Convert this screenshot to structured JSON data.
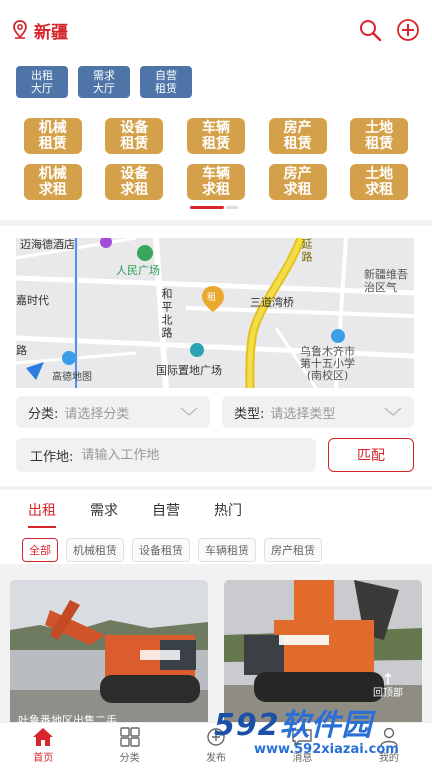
{
  "header": {
    "city": "新疆",
    "icons": [
      "location-pin-icon",
      "search-icon",
      "add-circle-icon"
    ],
    "accent": "#d7262b"
  },
  "halls": [
    {
      "label": "出租\n大厅"
    },
    {
      "label": "需求\n大厅"
    },
    {
      "label": "自营\n租赁"
    }
  ],
  "categories": [
    {
      "label": "机械\n租赁"
    },
    {
      "label": "设备\n租赁"
    },
    {
      "label": "车辆\n租赁"
    },
    {
      "label": "房产\n租赁"
    },
    {
      "label": "土地\n租赁"
    },
    {
      "label": "机械\n求租"
    },
    {
      "label": "设备\n求租"
    },
    {
      "label": "车辆\n求租"
    },
    {
      "label": "房产\n求租"
    },
    {
      "label": "土地\n求租"
    }
  ],
  "map": {
    "labels": {
      "hotel": "迈海德酒店",
      "people_square": "人民广场",
      "era": "嘉时代",
      "heping_road": "和平北路",
      "rent_marker": "租",
      "sandaowan": "三道湾桥",
      "xinjiang_uyghur": "新疆维吾\n治区气",
      "intl_plaza": "国际置地广场",
      "school": "乌鲁木齐市\n第十五小学\n(南校区)",
      "road_left": "路",
      "road_top": "延路",
      "logo": "高德地图"
    }
  },
  "filters": {
    "category_label": "分类:",
    "category_placeholder": "请选择分类",
    "type_label": "类型:",
    "type_placeholder": "请选择类型",
    "work_label": "工作地:",
    "work_placeholder": "请输入工作地",
    "match_button": "匹配"
  },
  "tabs": [
    {
      "label": "出租"
    },
    {
      "label": "需求"
    },
    {
      "label": "自营"
    },
    {
      "label": "热门"
    }
  ],
  "chips": [
    {
      "label": "全部"
    },
    {
      "label": "机械租赁"
    },
    {
      "label": "设备租赁"
    },
    {
      "label": "车辆租赁"
    },
    {
      "label": "房产租赁"
    }
  ],
  "products": [
    {
      "title": "叶鲁番地区出售二手"
    },
    {
      "title": ""
    }
  ],
  "to_top": "回顶部",
  "bottom_nav": [
    {
      "label": "首页"
    },
    {
      "label": "分类"
    },
    {
      "label": "发布"
    },
    {
      "label": "消息"
    },
    {
      "label": "我的"
    }
  ],
  "watermark": {
    "brand_num": "592",
    "brand_text": "软件园",
    "site": "www.592xiazai.com"
  }
}
